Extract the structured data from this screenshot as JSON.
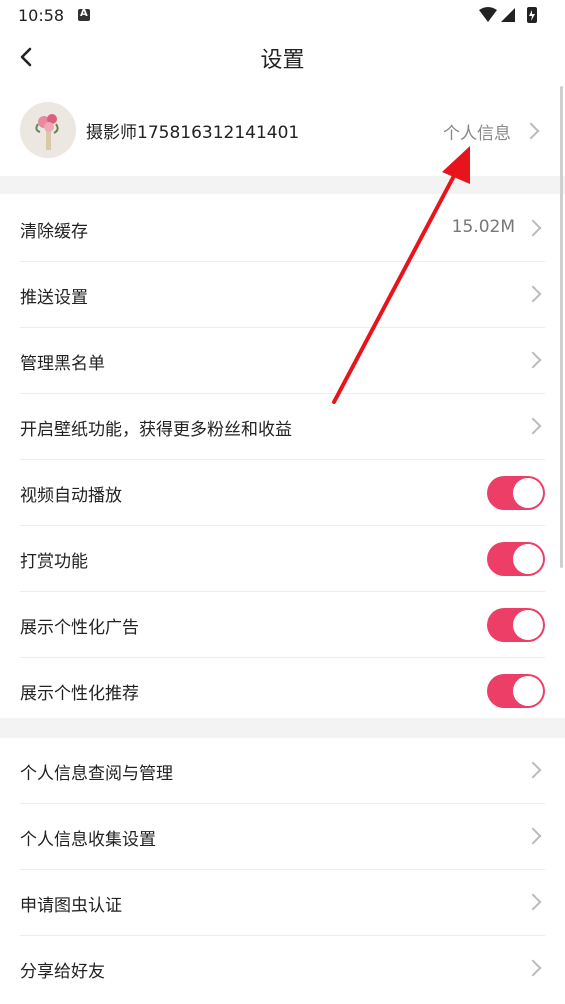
{
  "status_bar": {
    "time": "10:58"
  },
  "header": {
    "title": "设置"
  },
  "profile": {
    "username": "摄影师175816312141401",
    "info_label": "个人信息"
  },
  "section1": [
    {
      "label": "清除缓存",
      "value": "15.02M"
    },
    {
      "label": "推送设置"
    },
    {
      "label": "管理黑名单"
    },
    {
      "label": "开启壁纸功能，获得更多粉丝和收益"
    }
  ],
  "toggles": [
    {
      "label": "视频自动播放",
      "on": true
    },
    {
      "label": "打赏功能",
      "on": true
    },
    {
      "label": "展示个性化广告",
      "on": true
    },
    {
      "label": "展示个性化推荐",
      "on": true
    }
  ],
  "section2": [
    {
      "label": "个人信息查阅与管理"
    },
    {
      "label": "个人信息收集设置"
    },
    {
      "label": "申请图虫认证"
    },
    {
      "label": "分享给好友"
    }
  ],
  "colors": {
    "accent": "#ec3e66",
    "annotation_arrow": "#e8141c"
  }
}
